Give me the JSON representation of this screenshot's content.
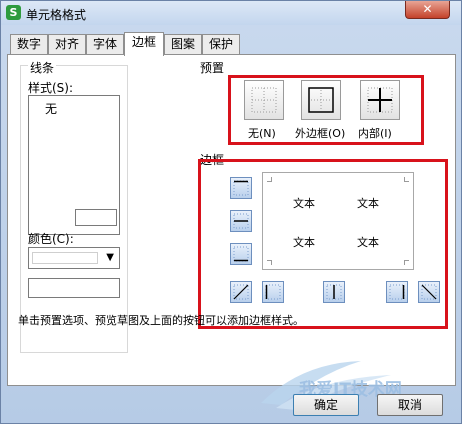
{
  "window": {
    "title": "单元格格式",
    "app_icon": "S",
    "close_glyph": "✕"
  },
  "tabs": [
    {
      "label": "数字"
    },
    {
      "label": "对齐"
    },
    {
      "label": "字体"
    },
    {
      "label": "边框"
    },
    {
      "label": "图案"
    },
    {
      "label": "保护"
    }
  ],
  "active_tab": "边框",
  "line_section": {
    "title": "线条",
    "style_label": "样式(S):",
    "style_selected": "无",
    "color_label": "颜色(C):"
  },
  "presets": {
    "title": "预置",
    "items": [
      {
        "label": "无(N)"
      },
      {
        "label": "外边框(O)"
      },
      {
        "label": "内部(I)"
      }
    ]
  },
  "border": {
    "title": "边框",
    "preview_texts": [
      "文本",
      "文本",
      "文本",
      "文本"
    ]
  },
  "hint": "单击预置选项、预览草图及上面的按钮可以添加边框样式。",
  "footer": {
    "ok": "确定",
    "cancel": "取消"
  },
  "watermark": "我爱IT技术网",
  "colors": {
    "highlight": "#d8121b",
    "title_bg": "#c3d6ee",
    "close": "#c4412a"
  }
}
